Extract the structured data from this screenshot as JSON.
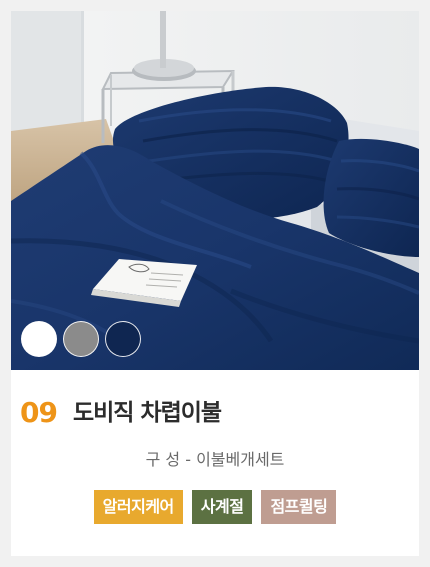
{
  "product": {
    "number": "09",
    "name": "도비직 차렵이불",
    "composition": "구 성 - 이불베개세트",
    "image_alt": "Navy dobby-weave duvet and pillows on a bed"
  },
  "color_swatches": [
    {
      "name": "white",
      "color": "#ffffff"
    },
    {
      "name": "gray",
      "color": "#8b8b8b"
    },
    {
      "name": "navy",
      "color": "#0f2651"
    }
  ],
  "tags": [
    {
      "label": "알러지케어",
      "color": "#e8a92e"
    },
    {
      "label": "사계절",
      "color": "#5c7142"
    },
    {
      "label": "점프퀼팅",
      "color": "#bf9d91"
    }
  ]
}
